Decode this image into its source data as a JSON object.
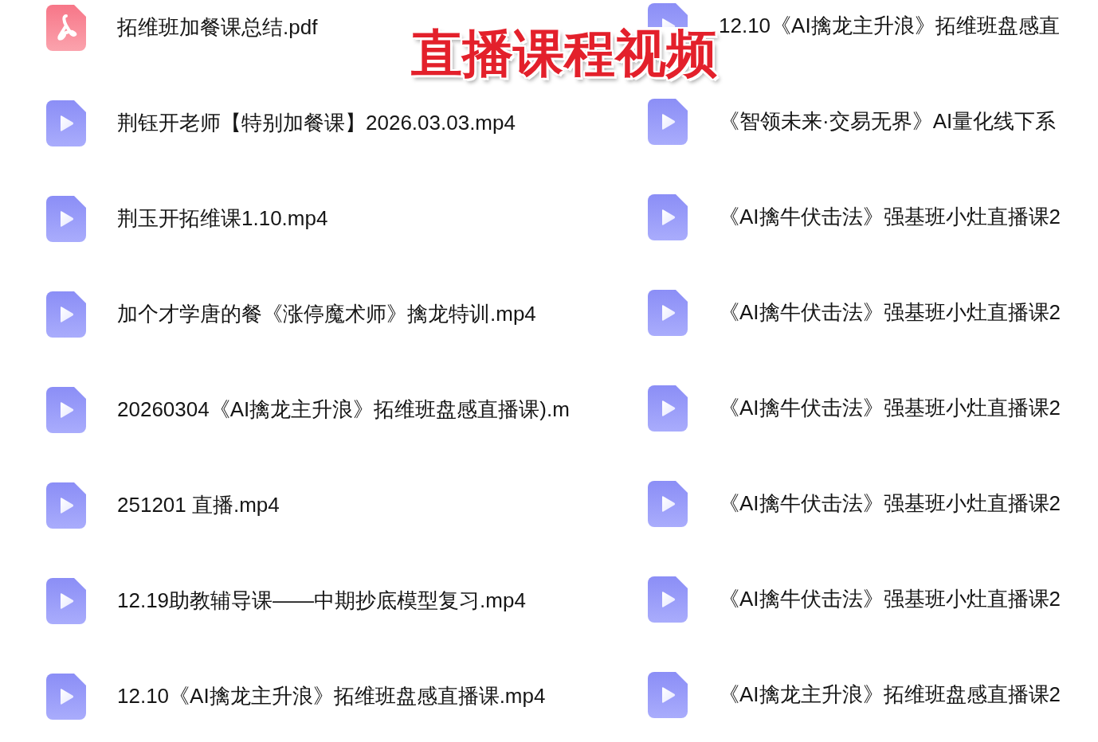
{
  "overlay_title": "直播课程视频",
  "columns": [
    {
      "files": [
        {
          "kind": "pdf",
          "name": "拓维班加餐课总结.pdf"
        },
        {
          "kind": "video",
          "name": "荆钰开老师【特别加餐课】2026.03.03.mp4"
        },
        {
          "kind": "video",
          "name": "荆玉开拓维课1.10.mp4"
        },
        {
          "kind": "video",
          "name": "加个才学唐的餐《涨停魔术师》擒龙特训.mp4"
        },
        {
          "kind": "video",
          "name": "20260304《AI擒龙主升浪》拓维班盘感直播课).m"
        },
        {
          "kind": "video",
          "name": "251201 直播.mp4"
        },
        {
          "kind": "video",
          "name": "12.19助教辅导课——中期抄底模型复习.mp4"
        },
        {
          "kind": "video",
          "name": "12.10《AI擒龙主升浪》拓维班盘感直播课.mp4"
        }
      ]
    },
    {
      "files": [
        {
          "kind": "video",
          "name": "12.10《AI擒龙主升浪》拓维班盘感直"
        },
        {
          "kind": "video",
          "name": "《智领未来·交易无界》AI量化线下系"
        },
        {
          "kind": "video",
          "name": "《AI擒牛伏击法》强基班小灶直播课2"
        },
        {
          "kind": "video",
          "name": "《AI擒牛伏击法》强基班小灶直播课2"
        },
        {
          "kind": "video",
          "name": "《AI擒牛伏击法》强基班小灶直播课2"
        },
        {
          "kind": "video",
          "name": "《AI擒牛伏击法》强基班小灶直播课2"
        },
        {
          "kind": "video",
          "name": "《AI擒牛伏击法》强基班小灶直播课2"
        },
        {
          "kind": "video",
          "name": "《AI擒龙主升浪》拓维班盘感直播课2"
        }
      ]
    }
  ]
}
